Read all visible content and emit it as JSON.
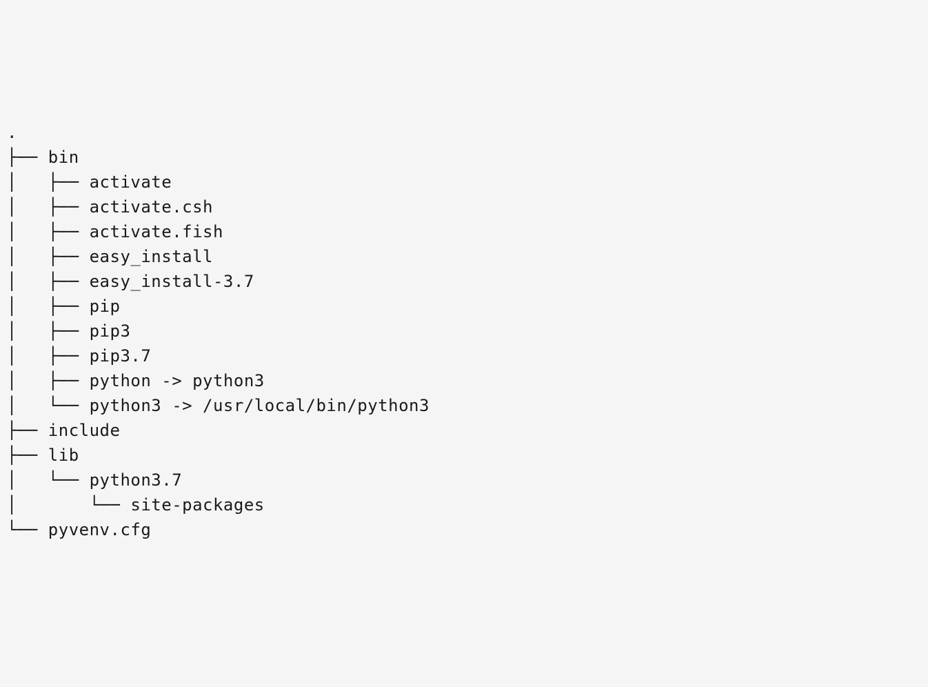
{
  "tree": {
    "lines": [
      ".",
      "├── bin",
      "│   ├── activate",
      "│   ├── activate.csh",
      "│   ├── activate.fish",
      "│   ├── easy_install",
      "│   ├── easy_install-3.7",
      "│   ├── pip",
      "│   ├── pip3",
      "│   ├── pip3.7",
      "│   ├── python -> python3",
      "│   └── python3 -> /usr/local/bin/python3",
      "├── include",
      "├── lib",
      "│   └── python3.7",
      "│       └── site-packages",
      "└── pyvenv.cfg"
    ]
  }
}
